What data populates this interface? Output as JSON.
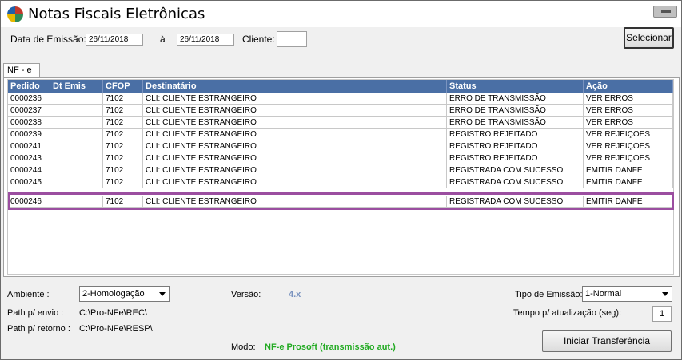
{
  "window": {
    "title": "Notas Fiscais Eletrônicas",
    "accent": "#4a6fa5",
    "highlight_color": "#9b4ea0"
  },
  "filters": {
    "emission_label": "Data de Emissão:",
    "date_from": "26/11/2018",
    "to_label": "à",
    "date_to": "26/11/2018",
    "client_label": "Cliente:",
    "client_value": "",
    "select_button": "Selecionar"
  },
  "tabs": [
    {
      "label": "NF - e"
    }
  ],
  "grid": {
    "columns": [
      "Pedido",
      "Dt Emis",
      "CFOP",
      "Destinatário",
      "Status",
      "Ação"
    ],
    "rows": [
      {
        "pedido": "0000236",
        "dt_emis": "",
        "cfop": "7102",
        "destinatario": "CLI: CLIENTE ESTRANGEIRO",
        "status": "ERRO DE TRANSMISSÃO",
        "acao": "VER ERROS"
      },
      {
        "pedido": "0000237",
        "dt_emis": "",
        "cfop": "7102",
        "destinatario": "CLI: CLIENTE ESTRANGEIRO",
        "status": "ERRO DE TRANSMISSÃO",
        "acao": "VER ERROS"
      },
      {
        "pedido": "0000238",
        "dt_emis": "",
        "cfop": "7102",
        "destinatario": "CLI: CLIENTE ESTRANGEIRO",
        "status": "ERRO DE TRANSMISSÃO",
        "acao": "VER ERROS"
      },
      {
        "pedido": "0000239",
        "dt_emis": "",
        "cfop": "7102",
        "destinatario": "CLI: CLIENTE ESTRANGEIRO",
        "status": "REGISTRO REJEITADO",
        "acao": "VER REJEIÇOES"
      },
      {
        "pedido": "0000241",
        "dt_emis": "",
        "cfop": "7102",
        "destinatario": "CLI: CLIENTE ESTRANGEIRO",
        "status": "REGISTRO REJEITADO",
        "acao": "VER REJEIÇOES"
      },
      {
        "pedido": "0000243",
        "dt_emis": "",
        "cfop": "7102",
        "destinatario": "CLI: CLIENTE ESTRANGEIRO",
        "status": "REGISTRO REJEITADO",
        "acao": "VER REJEIÇOES"
      },
      {
        "pedido": "0000244",
        "dt_emis": "",
        "cfop": "7102",
        "destinatario": "CLI: CLIENTE ESTRANGEIRO",
        "status": "REGISTRADA COM SUCESSO",
        "acao": "EMITIR DANFE"
      },
      {
        "pedido": "0000245",
        "dt_emis": "",
        "cfop": "7102",
        "destinatario": "CLI: CLIENTE ESTRANGEIRO",
        "status": "REGISTRADA COM SUCESSO",
        "acao": "EMITIR DANFE"
      },
      {
        "pedido": "0000246",
        "dt_emis": "",
        "cfop": "7102",
        "destinatario": "CLI: CLIENTE ESTRANGEIRO",
        "status": "REGISTRADA COM SUCESSO",
        "acao": "EMITIR DANFE"
      }
    ]
  },
  "footer": {
    "ambiente_label": "Ambiente :",
    "ambiente_value": "2-Homologação",
    "versao_label": "Versão:",
    "versao_value": "4.x",
    "tipo_emissao_label": "Tipo de Emissão:",
    "tipo_emissao_value": "1-Normal",
    "path_envio_label": "Path p/ envio :",
    "path_envio_value": "C:\\Pro-NFe\\REC\\",
    "tempo_label": "Tempo p/ atualização (seg):",
    "tempo_value": "1",
    "path_retorno_label": "Path p/ retorno :",
    "path_retorno_value": "C:\\Pro-NFe\\RESP\\",
    "modo_label": "Modo:",
    "modo_value": "NF-e Prosoft (transmissão aut.)",
    "start_button": "Iniciar Transferência"
  }
}
